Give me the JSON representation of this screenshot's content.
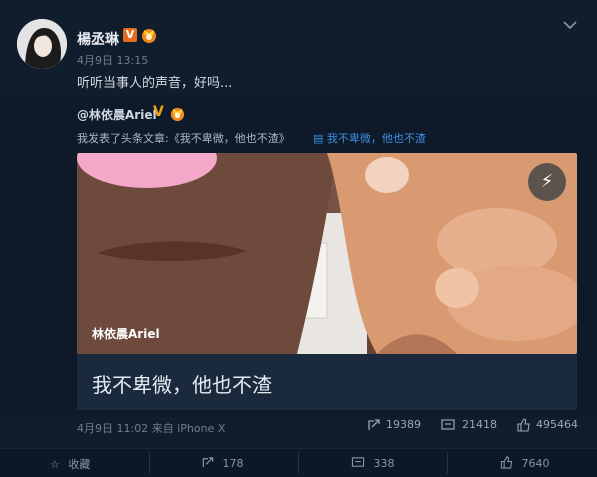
{
  "post": {
    "author": "楊丞琳",
    "badge": "V",
    "time": "4月9日 13:15",
    "text": "听听当事人的声音，好吗..."
  },
  "repost": {
    "author": "@林依晨Ariel",
    "verified": "V",
    "text": "我发表了头条文章:《我不卑微，他也不渣》",
    "link_label": "我不卑微，他也不渣",
    "image_caption": "林依晨Ariel",
    "article_title": "我不卑微，他也不渣",
    "meta": "4月9日 11:02 来自 iPhone X",
    "stats": {
      "reposts": "19389",
      "comments": "21418",
      "likes": "495464"
    }
  },
  "actions": {
    "favorite": "收藏",
    "repost": "178",
    "comment": "338",
    "like": "7640"
  },
  "colors": {
    "background": "#0b1624",
    "link": "#3d8fe0",
    "badge": "#e86a1c"
  }
}
